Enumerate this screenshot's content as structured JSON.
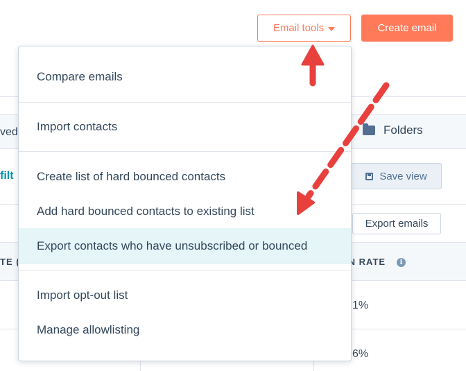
{
  "header": {
    "email_tools_label": "Email tools",
    "create_email_label": "Create email"
  },
  "background": {
    "tab_partial": "ved",
    "folders_label": "Folders",
    "filter_partial": "filt",
    "save_view_label": "Save view",
    "export_emails_label": "Export emails",
    "col_rate_partial": "TE (",
    "col_open_rate_partial": "EN RATE",
    "row1_open_rate": "1%",
    "row2_open_rate": "6%"
  },
  "dropdown": {
    "items": [
      {
        "label": "Compare emails"
      },
      {
        "label": "Import contacts"
      },
      {
        "label": "Create list of hard bounced contacts"
      },
      {
        "label": "Add hard bounced contacts to existing list"
      },
      {
        "label": "Export contacts who have unsubscribed or bounced"
      },
      {
        "label": "Import opt-out list"
      },
      {
        "label": "Manage allowlisting"
      }
    ]
  },
  "colors": {
    "accent": "#ff7a59",
    "annotation_arrow": "#e8413d",
    "highlight": "#e5f5f8"
  }
}
